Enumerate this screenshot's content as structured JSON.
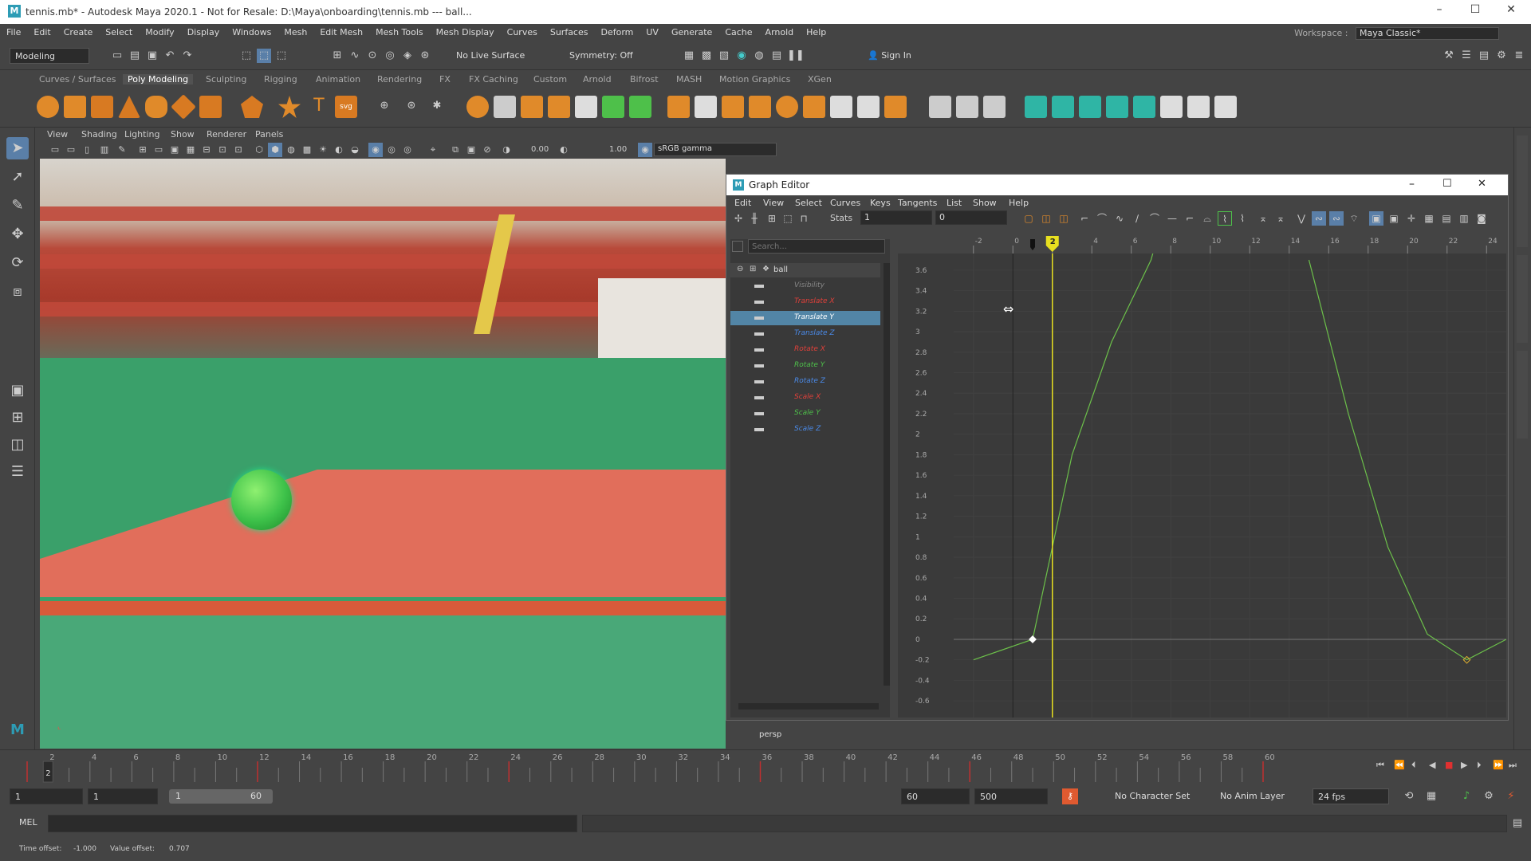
{
  "window": {
    "title": "tennis.mb* - Autodesk Maya 2020.1 - Not for Resale: D:\\Maya\\onboarding\\tennis.mb   ---   ball...",
    "logo": "M",
    "minimize": "–",
    "maximize": "☐",
    "close": "✕"
  },
  "menubar": {
    "items": [
      "File",
      "Edit",
      "Create",
      "Select",
      "Modify",
      "Display",
      "Windows",
      "Mesh",
      "Edit Mesh",
      "Mesh Tools",
      "Mesh Display",
      "Curves",
      "Surfaces",
      "Deform",
      "UV",
      "Generate",
      "Cache",
      "Arnold",
      "Help"
    ],
    "workspace_label": "Workspace :",
    "workspace_value": "Maya Classic*"
  },
  "statusline": {
    "mode": "Modeling",
    "live_surface": "No Live Surface",
    "symmetry": "Symmetry: Off",
    "sign_in": "Sign In"
  },
  "shelf_tabs": [
    "Curves / Surfaces",
    "Poly Modeling",
    "Sculpting",
    "Rigging",
    "Animation",
    "Rendering",
    "FX",
    "FX Caching",
    "Custom",
    "Arnold",
    "Bifrost",
    "MASH",
    "Motion Graphics",
    "XGen"
  ],
  "shelf_active": "Poly Modeling",
  "panel_menu": [
    "View",
    "Shading",
    "Lighting",
    "Show",
    "Renderer",
    "Panels"
  ],
  "panel_toolbar": {
    "exposure": "0.00",
    "gamma": "1.00",
    "color_space": "sRGB gamma"
  },
  "viewport": {
    "camera": "persp"
  },
  "graph_editor": {
    "title": "Graph Editor",
    "menu": [
      "Edit",
      "View",
      "Select",
      "Curves",
      "Keys",
      "Tangents",
      "List",
      "Show",
      "Help"
    ],
    "stats_label": "Stats",
    "stats_frame": "1",
    "stats_value": "0",
    "search_placeholder": "Search...",
    "object": "ball",
    "channels": [
      {
        "name": "Visibility",
        "color": "#888888"
      },
      {
        "name": "Translate X",
        "color": "#e0403a"
      },
      {
        "name": "Translate Y",
        "color": "#ffffff",
        "selected": true
      },
      {
        "name": "Translate Z",
        "color": "#4a8ae8"
      },
      {
        "name": "Rotate X",
        "color": "#e0403a"
      },
      {
        "name": "Rotate Y",
        "color": "#4ec04a"
      },
      {
        "name": "Rotate Z",
        "color": "#4a8ae8"
      },
      {
        "name": "Scale X",
        "color": "#e0403a"
      },
      {
        "name": "Scale Y",
        "color": "#4ec04a"
      },
      {
        "name": "Scale Z",
        "color": "#4a8ae8"
      }
    ],
    "time_ticks": [
      "-2",
      "0",
      "2",
      "4",
      "6",
      "8",
      "10",
      "12",
      "14",
      "16",
      "18",
      "20",
      "22",
      "24"
    ],
    "current_frame": "2",
    "value_ticks": [
      "3.6",
      "3.4",
      "3.2",
      "3",
      "2.8",
      "2.6",
      "2.4",
      "2.2",
      "2",
      "1.8",
      "1.6",
      "1.4",
      "1.2",
      "1",
      "0.8",
      "0.6",
      "0.4",
      "0.2",
      "0",
      "-0.2",
      "-0.4",
      "-0.6"
    ],
    "curve_color": "#6cc04a",
    "cursor_color": "#e8e020"
  },
  "chart_data": {
    "type": "line",
    "xlim": [
      -3,
      25
    ],
    "ylim": [
      -0.7,
      3.7
    ],
    "series": [
      {
        "values_xy": [
          [
            -2,
            -0.2
          ],
          [
            1,
            0
          ],
          [
            3,
            1.8
          ],
          [
            5,
            2.9
          ],
          [
            7,
            3.7
          ],
          [
            8,
            4.4
          ]
        ]
      },
      {
        "values_xy": [
          [
            15,
            3.7
          ],
          [
            17,
            2.2
          ],
          [
            19,
            0.9
          ],
          [
            21,
            0.05
          ],
          [
            23,
            -0.2
          ],
          [
            25,
            0.0
          ]
        ]
      }
    ],
    "keys": [
      [
        1,
        0
      ],
      [
        23,
        -0.2
      ]
    ]
  },
  "timeslider": {
    "ticks": [
      "2",
      "4",
      "6",
      "8",
      "10",
      "12",
      "14",
      "16",
      "18",
      "20",
      "22",
      "24",
      "26",
      "28",
      "30",
      "32",
      "34",
      "36",
      "38",
      "40",
      "42",
      "44",
      "46",
      "48",
      "50",
      "52",
      "54",
      "56",
      "58",
      "60"
    ],
    "current": "2"
  },
  "rangeslider": {
    "start": "1",
    "playback_start": "1",
    "range_start": "1",
    "range_end": "60",
    "playback_end": "60",
    "end": "500",
    "character_set": "No Character Set",
    "anim_layer": "No Anim Layer",
    "fps": "24 fps"
  },
  "cmdline": {
    "label": "MEL"
  },
  "helpline": {
    "time_offset_label": "Time offset:",
    "time_offset": "-1.000",
    "value_offset_label": "Value offset:",
    "value_offset": "0.707"
  }
}
